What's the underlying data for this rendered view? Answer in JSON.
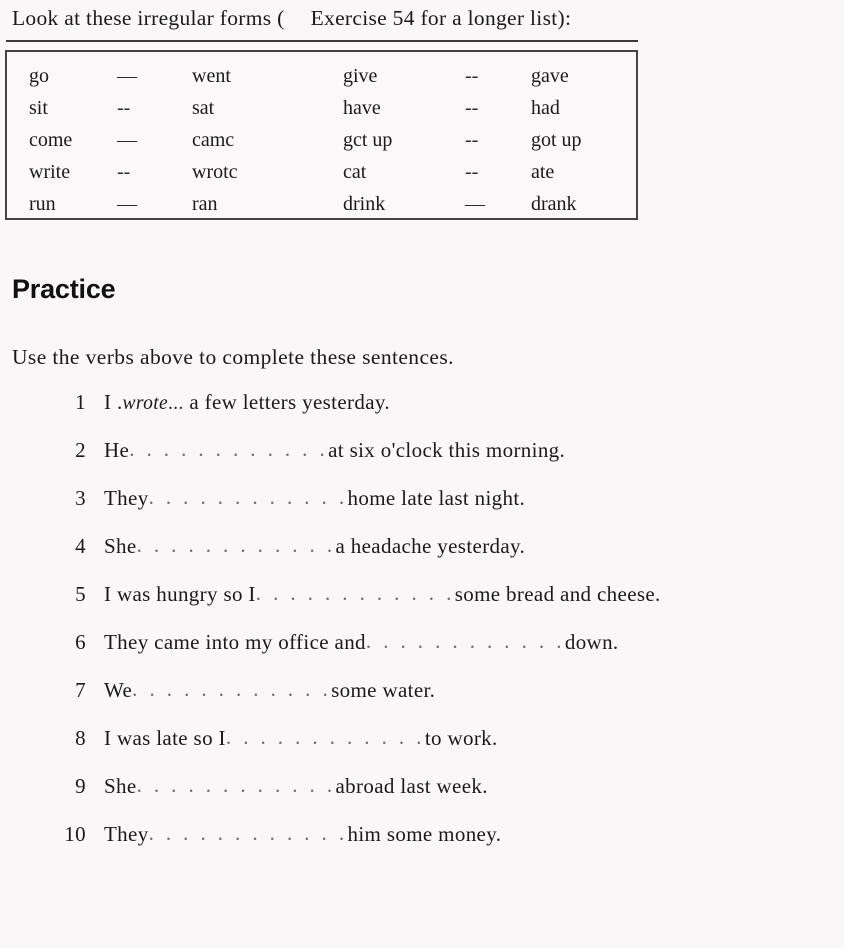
{
  "intro": {
    "before_paren": "Look at these irregular forms (",
    "reference": "Exercise 54 for a longer list):"
  },
  "verb_table": {
    "rows": [
      {
        "base_left": "go",
        "dash_left": "—",
        "past_left": "went",
        "base_right": "give",
        "dash_right": "--",
        "past_right": "gave"
      },
      {
        "base_left": "sit",
        "dash_left": "--",
        "past_left": "sat",
        "base_right": "have",
        "dash_right": "--",
        "past_right": "had"
      },
      {
        "base_left": "come",
        "dash_left": "—",
        "past_left": "camc",
        "base_right": "gct up",
        "dash_right": "--",
        "past_right": "got up"
      },
      {
        "base_left": "write",
        "dash_left": "--",
        "past_left": "wrotc",
        "base_right": "cat",
        "dash_right": "--",
        "past_right": "ate"
      },
      {
        "base_left": "run",
        "dash_left": "—",
        "past_left": "ran",
        "base_right": "drink",
        "dash_right": "—",
        "past_right": "drank"
      }
    ]
  },
  "practice": {
    "heading": "Practice",
    "instruction": "Use the verbs above to complete these sentences.",
    "blank_dots": ". . . . . . . . . . . .",
    "items": [
      {
        "number": "1",
        "prefix": "I .",
        "answer": "wrote",
        "answer_dots": "...",
        "suffix": " a few letters yesterday.",
        "filled": true
      },
      {
        "number": "2",
        "prefix": "He",
        "suffix": "at six o'clock this morning.",
        "filled": false
      },
      {
        "number": "3",
        "prefix": "They",
        "suffix": "home late last night.",
        "filled": false
      },
      {
        "number": "4",
        "prefix": "She",
        "suffix": "a headache yesterday.",
        "filled": false
      },
      {
        "number": "5",
        "prefix": "I was hungry so I",
        "suffix": "some bread and cheese.",
        "filled": false
      },
      {
        "number": "6",
        "prefix": "They came into my office and",
        "suffix": "down.",
        "filled": false
      },
      {
        "number": "7",
        "prefix": "We",
        "suffix": "some water.",
        "filled": false
      },
      {
        "number": "8",
        "prefix": "I was late so I",
        "suffix": "to work.",
        "filled": false
      },
      {
        "number": "9",
        "prefix": "She",
        "suffix": "abroad last week.",
        "filled": false
      },
      {
        "number": "10",
        "prefix": "They",
        "suffix": "him some money.",
        "filled": false
      }
    ]
  },
  "colors": {
    "page_background": "#f9f7f7",
    "text": "#1a1a1a",
    "rule": "#3a3a3a",
    "box_border": "#444444",
    "dot_leader": "#6a6a6a"
  }
}
